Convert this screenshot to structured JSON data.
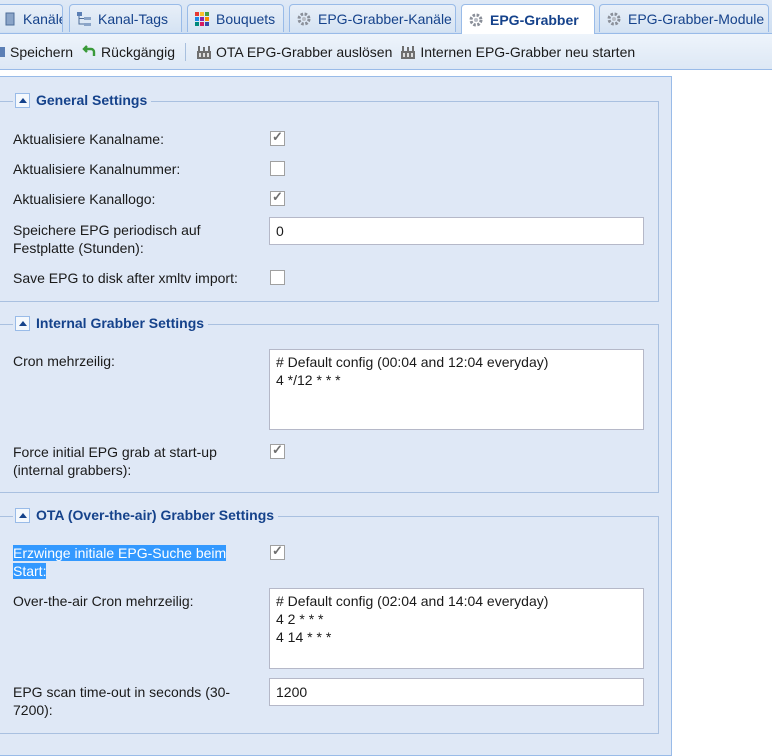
{
  "tabs": [
    {
      "label": "Kanäle",
      "icon": "channel-list-icon",
      "active": false
    },
    {
      "label": "Kanal-Tags",
      "icon": "tag-tree-icon",
      "active": false
    },
    {
      "label": "Bouquets",
      "icon": "bouquet-grid-icon",
      "active": false
    },
    {
      "label": "EPG-Grabber-Kanäle",
      "icon": "gear-icon",
      "active": false
    },
    {
      "label": "EPG-Grabber",
      "icon": "gear-icon",
      "active": true
    },
    {
      "label": "EPG-Grabber-Module",
      "icon": "gear-icon",
      "active": false
    }
  ],
  "toolbar": {
    "save_label": "Speichern",
    "undo_label": "Rückgängig",
    "ota_trigger_label": "OTA EPG-Grabber auslösen",
    "restart_internal_label": "Internen EPG-Grabber neu starten"
  },
  "general": {
    "title": "General Settings",
    "update_name_label": "Aktualisiere Kanalname:",
    "update_name_checked": true,
    "update_number_label": "Aktualisiere Kanalnummer:",
    "update_number_checked": false,
    "update_logo_label": "Aktualisiere Kanallogo:",
    "update_logo_checked": true,
    "periodic_save_label_1": "Speichere EPG periodisch auf",
    "periodic_save_label_2": "Festplatte (Stunden):",
    "periodic_save_value": "0",
    "save_after_xmltv_label": "Save EPG to disk after xmltv import:",
    "save_after_xmltv_checked": false
  },
  "internal": {
    "title": "Internal Grabber Settings",
    "cron_label": "Cron mehrzeilig:",
    "cron_value": "# Default config (00:04 and 12:04 everyday)\n4 */12 * * *",
    "force_initial_label_1": "Force initial EPG grab at start-up",
    "force_initial_label_2": "(internal grabbers):",
    "force_initial_checked": true
  },
  "ota": {
    "title": "OTA (Over-the-air) Grabber Settings",
    "force_initial_label_1": "Erzwinge initiale EPG-Suche beim",
    "force_initial_label_2": "Start:",
    "force_initial_checked": true,
    "cron_label": "Over-the-air Cron mehrzeilig:",
    "cron_value": "# Default config (02:04 and 14:04 everyday)\n4 2 * * *\n4 14 * * *",
    "timeout_label_1": "EPG scan time-out in seconds (30-",
    "timeout_label_2": "7200):",
    "timeout_value": "1200"
  },
  "colors": {
    "accent_text": "#15428b",
    "panel_bg": "#dfe8f6",
    "border": "#99bbe8",
    "selection": "#3399ff"
  }
}
